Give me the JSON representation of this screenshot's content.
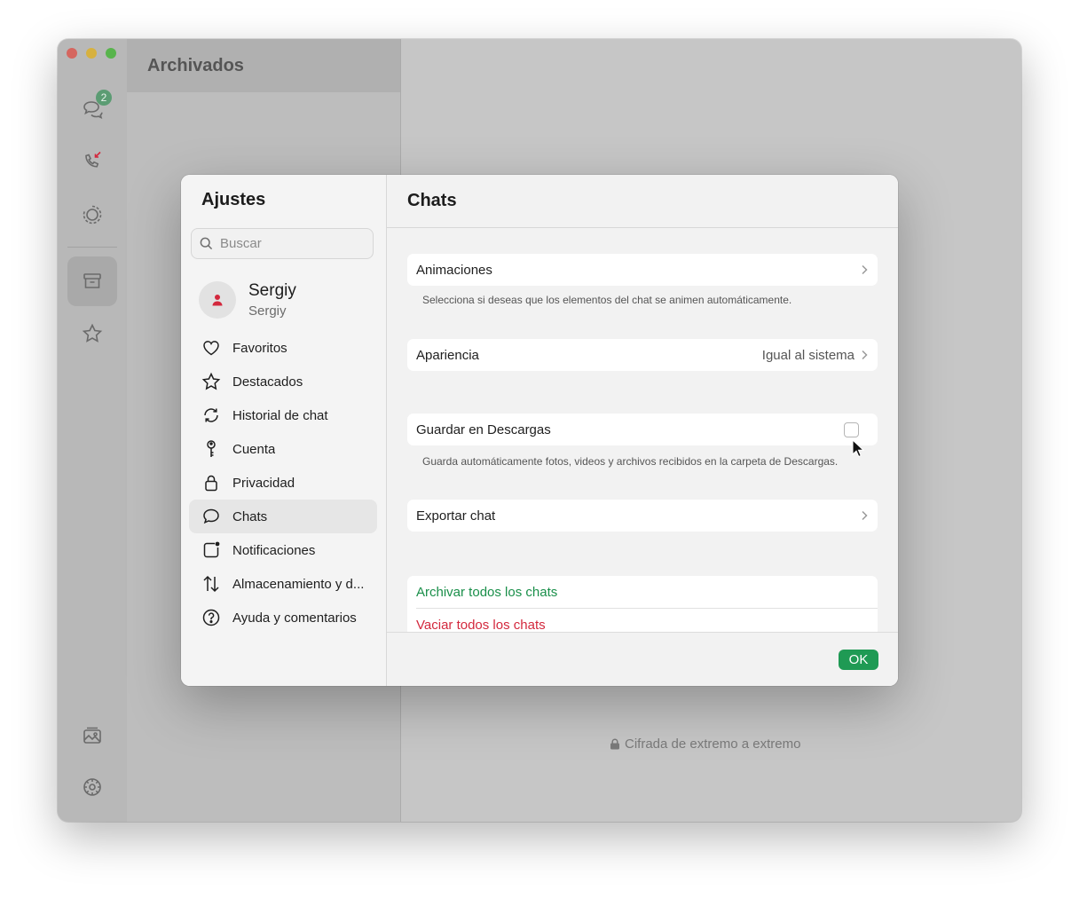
{
  "app": {
    "list_title": "Archivados",
    "unread_badge": "2",
    "encryption_note": "Cifrada de extremo a extremo"
  },
  "dialog": {
    "title": "Ajustes",
    "search_placeholder": "Buscar",
    "profile": {
      "name": "Sergiy",
      "subtitle": "Sergiy"
    },
    "menu": [
      {
        "label": "Favoritos",
        "icon": "heart-icon"
      },
      {
        "label": "Destacados",
        "icon": "star-icon"
      },
      {
        "label": "Historial de chat",
        "icon": "history-icon"
      },
      {
        "label": "Cuenta",
        "icon": "key-icon"
      },
      {
        "label": "Privacidad",
        "icon": "lock-icon"
      },
      {
        "label": "Chats",
        "icon": "chat-bubble-icon",
        "active": true
      },
      {
        "label": "Notificaciones",
        "icon": "notification-icon"
      },
      {
        "label": "Almacenamiento y d...",
        "icon": "arrows-updown-icon"
      },
      {
        "label": "Ayuda y comentarios",
        "icon": "help-icon"
      }
    ]
  },
  "chats_settings": {
    "title": "Chats",
    "animations_label": "Animaciones",
    "animations_desc": "Selecciona si deseas que los elementos del chat se animen automáticamente.",
    "appearance_label": "Apariencia",
    "appearance_value": "Igual al sistema",
    "save_downloads_label": "Guardar en Descargas",
    "save_downloads_checked": false,
    "save_downloads_desc": "Guarda automáticamente fotos, videos y archivos recibidos en la carpeta de Descargas.",
    "export_label": "Exportar chat",
    "archive_all_label": "Archivar todos los chats",
    "clear_all_label": "Vaciar todos los chats",
    "ok_label": "OK"
  },
  "colors": {
    "accent_green": "#1f9a54",
    "danger_red": "#d3283d"
  }
}
